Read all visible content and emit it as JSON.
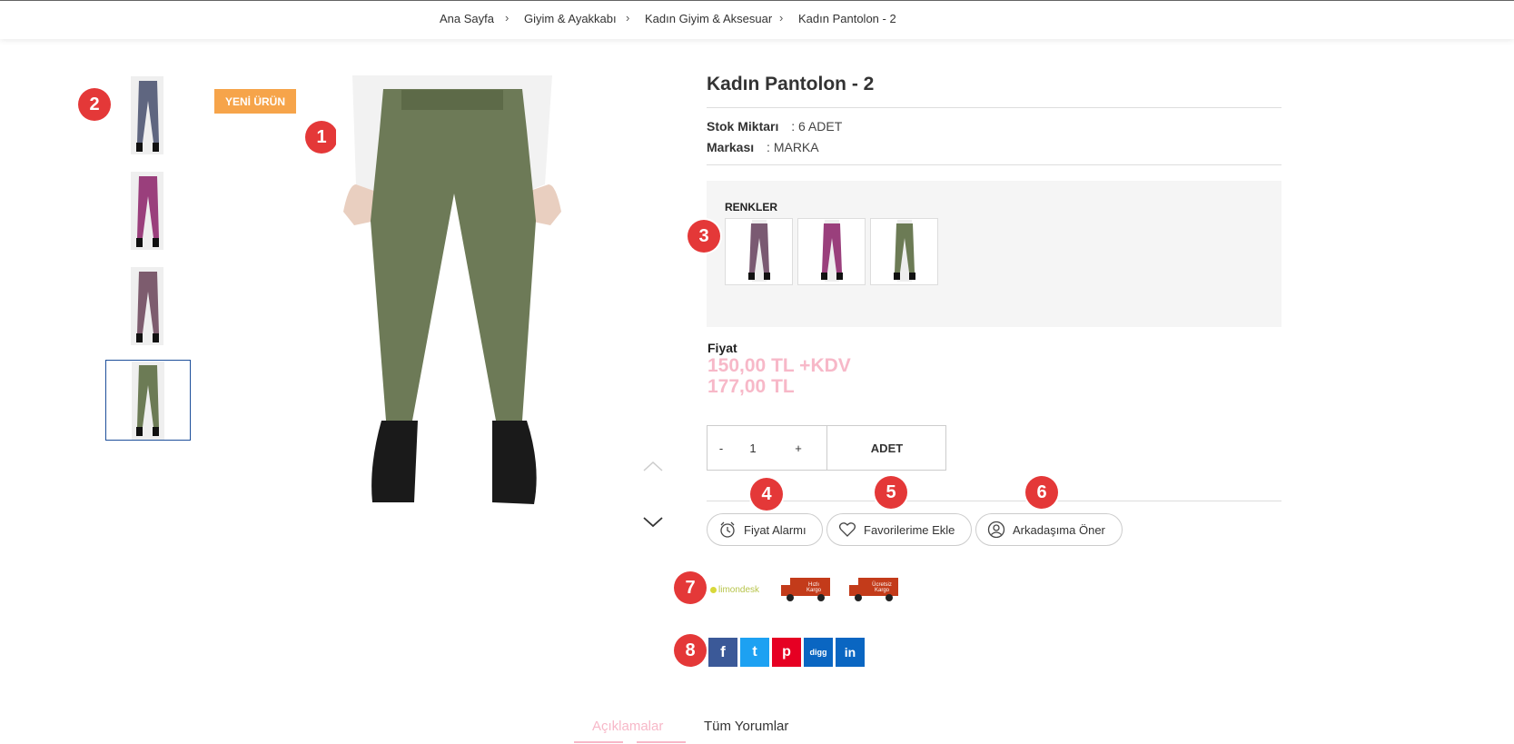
{
  "breadcrumb": {
    "items": [
      "Ana Sayfa",
      "Giyim & Ayakkabı",
      "Kadın Giyim & Aksesuar",
      "Kadın Pantolon - 2"
    ],
    "separator": "›"
  },
  "badges": {
    "b1": "1",
    "b2": "2",
    "b3": "3",
    "b4": "4",
    "b5": "5",
    "b6": "6",
    "b7": "7",
    "b8": "8"
  },
  "gallery": {
    "new_label": "YENİ ÜRÜN",
    "thumbnails": [
      {
        "color": "#5f6680"
      },
      {
        "color": "#9a3f7c"
      },
      {
        "color": "#7d5c6e"
      },
      {
        "color": "#6c7b55"
      }
    ],
    "main_color": "#6d7a57"
  },
  "product": {
    "title": "Kadın Pantolon - 2",
    "stock_label": "Stok Miktarı",
    "stock_value": ": 6 ADET",
    "brand_label": "Markası",
    "brand_value": ": MARKA",
    "colors_label": "RENKLER",
    "colors": [
      "#7a5a72",
      "#9a3f7c",
      "#6c7b55"
    ],
    "price_label": "Fiyat",
    "price_excl": "150,00 TL +KDV",
    "price_incl": "177,00 TL"
  },
  "quantity": {
    "minus": "-",
    "value": "1",
    "plus": "+",
    "unit": "ADET"
  },
  "actions": {
    "price_alarm": "Fiyat Alarmı",
    "favorites": "Favorilerime Ekle",
    "recommend": "Arkadaşıma Öner"
  },
  "shipping": {
    "brand": "limondesk",
    "fast": "Hızlı Kargo",
    "free": "Ücretsiz Kargo"
  },
  "social": {
    "facebook": "f",
    "twitter": "t",
    "pinterest": "p",
    "digg": "digg",
    "linkedin": "in"
  },
  "tabs": {
    "descriptions": "Açıklamalar",
    "reviews": "Tüm Yorumlar"
  },
  "colors": {
    "accent_pink": "#f7b8c8",
    "badge_red": "#e43838",
    "new_orange": "#f6a44a"
  }
}
